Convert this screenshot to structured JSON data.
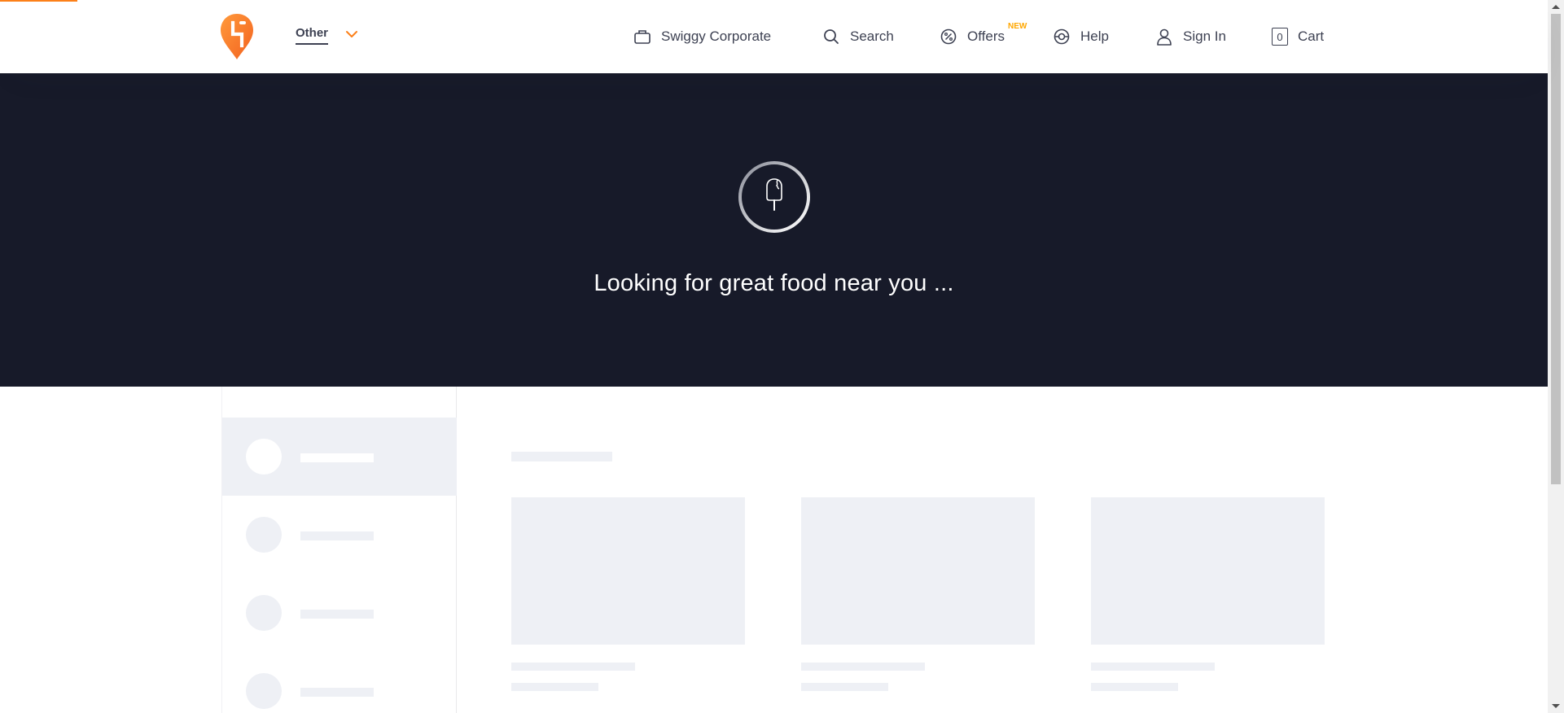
{
  "brand": {
    "logo": "swiggy-logo",
    "accent_color": "#fc8019"
  },
  "header": {
    "location_label": "Other",
    "nav": {
      "corporate": "Swiggy Corporate",
      "search": "Search",
      "offers": "Offers",
      "offers_badge": "NEW",
      "help": "Help",
      "sign_in": "Sign In",
      "cart": "Cart",
      "cart_count": "0"
    }
  },
  "hero": {
    "loading_text": "Looking for great food near you ...",
    "background_color": "#171a29",
    "icon": "ice-cream-icon"
  }
}
